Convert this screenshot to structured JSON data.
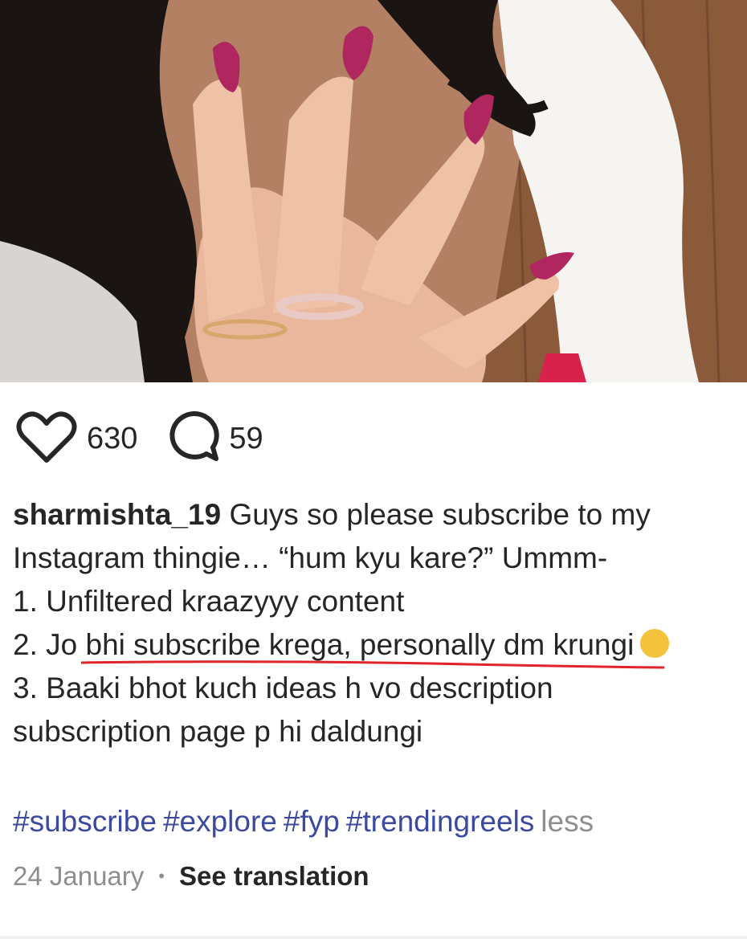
{
  "post": {
    "likes": "630",
    "comments": "59",
    "username": "sharmishta_19",
    "caption_lines": [
      "Guys so please subscribe to my",
      "Instagram thingie… “hum kyu kare?” Ummm-",
      "1. Unfiltered kraazyyy content",
      "2. Jo",
      "bhi subscribe krega, personally dm krungi",
      "3. Baaki bhot kuch ideas h vo description",
      "subscription page p hi daldungi"
    ],
    "hashtags": [
      "#subscribe",
      "#explore",
      "#fyp",
      "#trendingreels"
    ],
    "less_label": "less",
    "date": "24 January",
    "separator": "•",
    "translate_label": "See translation"
  },
  "icons": {
    "like": "heart-outline-icon",
    "comment": "speech-bubble-icon",
    "emoji": "laughing-tears-emoji"
  },
  "colors": {
    "text": "#262626",
    "muted": "#8e8e8e",
    "hashtag": "#3b4aa0",
    "underline_marker": "#e0242a",
    "nail_polish": "#b0265f"
  }
}
